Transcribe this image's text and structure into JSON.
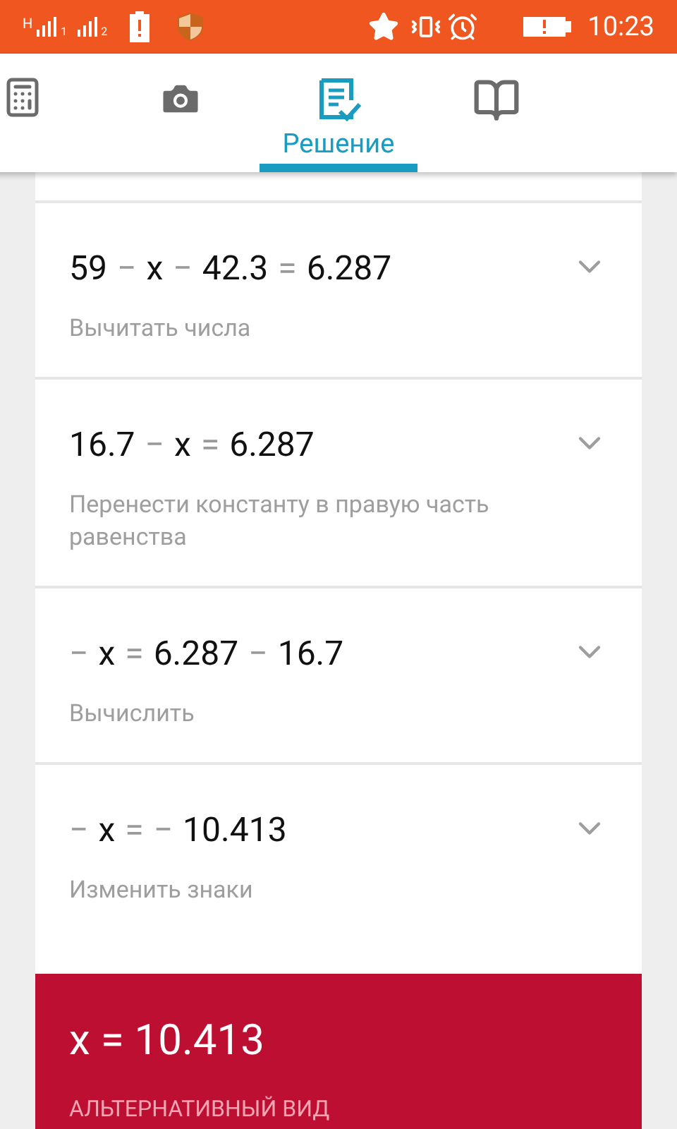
{
  "status_bar": {
    "network": "H",
    "sim_1": "1",
    "sim_2": "2",
    "time": "10:23"
  },
  "tabs": [
    {
      "kind": "calculator",
      "selected": false
    },
    {
      "kind": "camera",
      "selected": false
    },
    {
      "kind": "solution",
      "label": "Решение",
      "selected": true
    },
    {
      "kind": "book",
      "selected": false
    }
  ],
  "steps": [
    {
      "equation": [
        {
          "kind": "term",
          "text": "59"
        },
        {
          "kind": "op",
          "text": "−"
        },
        {
          "kind": "term",
          "text": "x"
        },
        {
          "kind": "op",
          "text": "−"
        },
        {
          "kind": "term",
          "text": "42.3"
        },
        {
          "kind": "op",
          "text": "="
        },
        {
          "kind": "term",
          "text": "6.287"
        }
      ],
      "description": "Вычитать числа",
      "expanded": false
    },
    {
      "equation": [
        {
          "kind": "term",
          "text": "16.7"
        },
        {
          "kind": "op",
          "text": "−"
        },
        {
          "kind": "term",
          "text": "x"
        },
        {
          "kind": "op",
          "text": "="
        },
        {
          "kind": "term",
          "text": "6.287"
        }
      ],
      "description": "Перенести константу в правую часть равенства",
      "expanded": false
    },
    {
      "equation": [
        {
          "kind": "op",
          "text": "−"
        },
        {
          "kind": "term",
          "text": "x"
        },
        {
          "kind": "op",
          "text": "="
        },
        {
          "kind": "term",
          "text": "6.287"
        },
        {
          "kind": "op",
          "text": "−"
        },
        {
          "kind": "term",
          "text": "16.7"
        }
      ],
      "description": "Вычислить",
      "expanded": false
    },
    {
      "equation": [
        {
          "kind": "op",
          "text": "−"
        },
        {
          "kind": "term",
          "text": "x"
        },
        {
          "kind": "op",
          "text": "="
        },
        {
          "kind": "op",
          "text": "−"
        },
        {
          "kind": "term",
          "text": "10.413"
        }
      ],
      "description": "Изменить знаки",
      "expanded": false
    }
  ],
  "result": {
    "answer": "x = 10.413",
    "alternative_link": "АЛЬТЕРНАТИВНЫЙ ВИД"
  }
}
